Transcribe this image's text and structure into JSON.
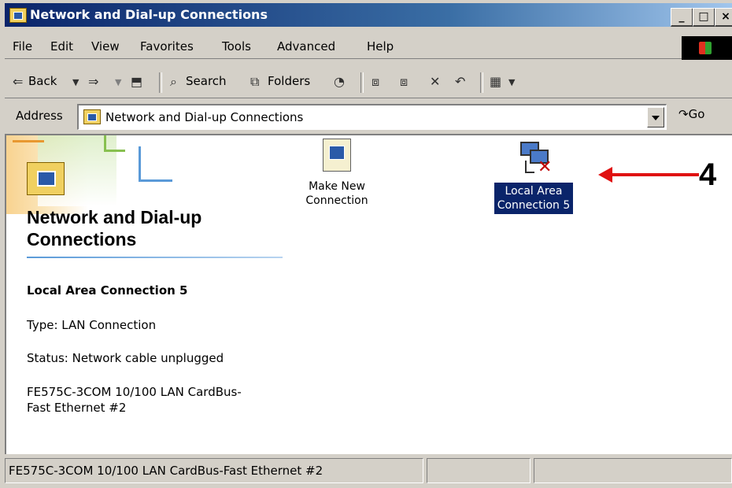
{
  "window": {
    "title": "Network and Dial-up Connections",
    "controls": [
      "_",
      "□",
      "×"
    ]
  },
  "menu": [
    "File",
    "Edit",
    "View",
    "Favorites",
    "Tools",
    "Advanced",
    "Help"
  ],
  "toolbar": {
    "back": "Back",
    "search": "Search",
    "folders": "Folders"
  },
  "address": {
    "label": "Address",
    "value": "Network and Dial-up Connections",
    "go": "Go"
  },
  "panel": {
    "title": "Network and Dial-up Connections",
    "selected_name": "Local Area Connection 5",
    "type": "Type: LAN Connection",
    "status": "Status: Network cable unplugged",
    "device": "FE575C-3COM 10/100 LAN CardBus-\nFast Ethernet #2"
  },
  "items": [
    {
      "label": "Make New\nConnection",
      "icon": "make-new-connection-icon"
    },
    {
      "label": "Local Area\nConnection 5",
      "icon": "lan-connection-disconnected-icon"
    }
  ],
  "annotation": {
    "callout": "4",
    "arrow_color": "#e01010"
  },
  "statusbar": {
    "text": "FE575C-3COM 10/100 LAN CardBus-Fast Ethernet #2"
  },
  "colors": {
    "titlebar": "#0a246a",
    "selection": "#0a246a",
    "face": "#d4d0c8"
  }
}
